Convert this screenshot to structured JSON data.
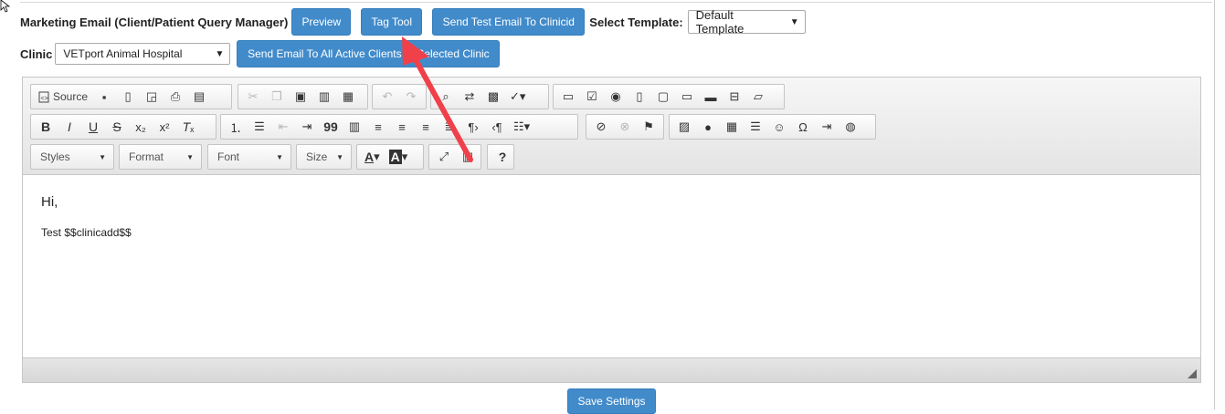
{
  "header": {
    "title": "Marketing Email (Client/Patient Query Manager)",
    "preview_label": "Preview",
    "tag_tool_label": "Tag Tool",
    "send_test_label": "Send Test Email To Clinicid",
    "select_template_label": "Select Template:",
    "template_value": "Default Template"
  },
  "clinic": {
    "label": "Clinic",
    "value": "VETport Animal Hospital",
    "send_all_label": "Send Email To All Active Clients of Selected Clinic"
  },
  "toolbar": {
    "source_label": "Source",
    "styles_label": "Styles",
    "format_label": "Format",
    "font_label": "Font",
    "size_label": "Size",
    "help_label": "?"
  },
  "editor": {
    "line1": "Hi,",
    "line2": "Test $$clinicadd$$"
  },
  "footer": {
    "save_label": "Save Settings"
  },
  "colors": {
    "button_primary": "#428bca",
    "annotation_arrow": "#f0404a"
  }
}
